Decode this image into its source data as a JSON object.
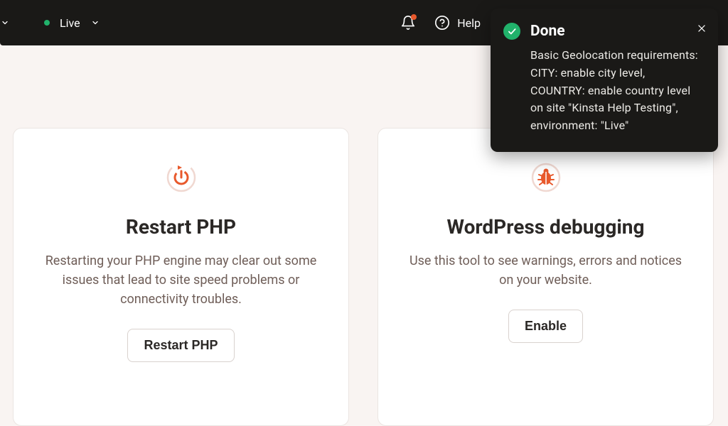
{
  "topbar": {
    "env_label": "Live",
    "help_label": "Help"
  },
  "toast": {
    "title": "Done",
    "body": "Basic Geolocation requirements: CITY: enable city level, COUNTRY: enable country level on site \"Kinsta Help Testing\", environment: \"Live\""
  },
  "cards": {
    "restart_php": {
      "title": "Restart PHP",
      "desc": "Restarting your PHP engine may clear out some issues that lead to site speed problems or connectivity troubles.",
      "button": "Restart PHP"
    },
    "wp_debug": {
      "title": "WordPress debugging",
      "desc": "Use this tool to see warnings, errors and notices on your website.",
      "button": "Enable"
    }
  }
}
